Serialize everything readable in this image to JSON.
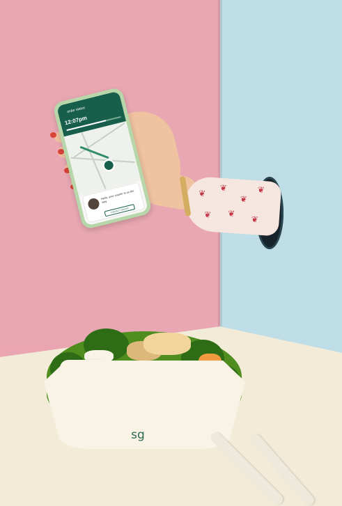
{
  "phone": {
    "status_label": "order status",
    "eta": "12:07pm",
    "progress": 0.72,
    "message": "Hello, your courier is on the way.",
    "contact_label": "CONTACT DRIVER"
  },
  "bowl": {
    "logo": "sg"
  },
  "colors": {
    "left_wall": "#e8a7b2",
    "right_wall": "#bfdde6",
    "table": "#f2ebd8",
    "phone_case": "#b7d7aa",
    "app_green": "#185f4b"
  }
}
